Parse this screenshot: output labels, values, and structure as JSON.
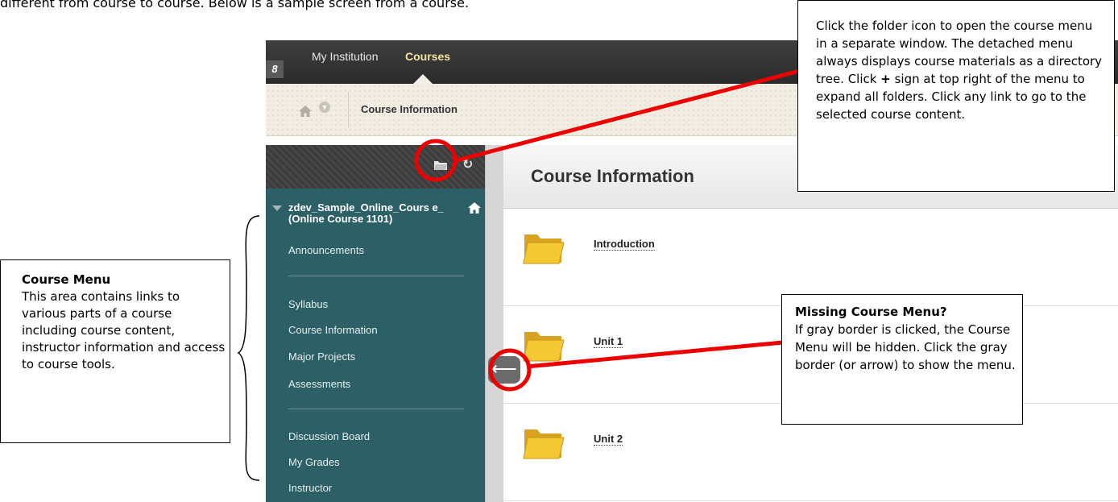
{
  "intro": "different from course to course.  Below is a sample screen from a course.",
  "topnav": {
    "my_institution": "My Institution",
    "courses": "Courses"
  },
  "breadcrumb": {
    "current": "Course Information"
  },
  "course_menu": {
    "title": "zdev_Sample_Online_Cours e_ (Online Course 1101)",
    "groups": [
      [
        "Announcements"
      ],
      [
        "Syllabus",
        "Course Information",
        "Major Projects",
        "Assessments"
      ],
      [
        "Discussion Board",
        "My Grades",
        "Instructor"
      ]
    ],
    "collapse_arrow": "⟵"
  },
  "content": {
    "title": "Course Information",
    "items": [
      "Introduction",
      "Unit 1",
      "Unit 2"
    ]
  },
  "annotations": {
    "folder": {
      "text_a": "Click the folder icon to open the course menu in a separate window. The detached menu always displays course materials as a directory tree. Click ",
      "bold": "+",
      "text_b": " sign at top right of the menu to expand all folders.  Click any link to go to the selected course content."
    },
    "course_menu": {
      "heading": "Course Menu",
      "body": "This area contains links to various parts of a course including course content, instructor information and access to course tools."
    },
    "missing": {
      "heading": "Missing Course Menu?",
      "body": "If gray border is clicked, the Course Menu will be hidden. Click the gray border (or arrow) to show the menu."
    }
  },
  "colors": {
    "menu_bg": "#2c6066",
    "topnav_bg": "#2b2b2b",
    "annotation_red": "#ee0000",
    "folder_yellow": "#f2c530"
  }
}
